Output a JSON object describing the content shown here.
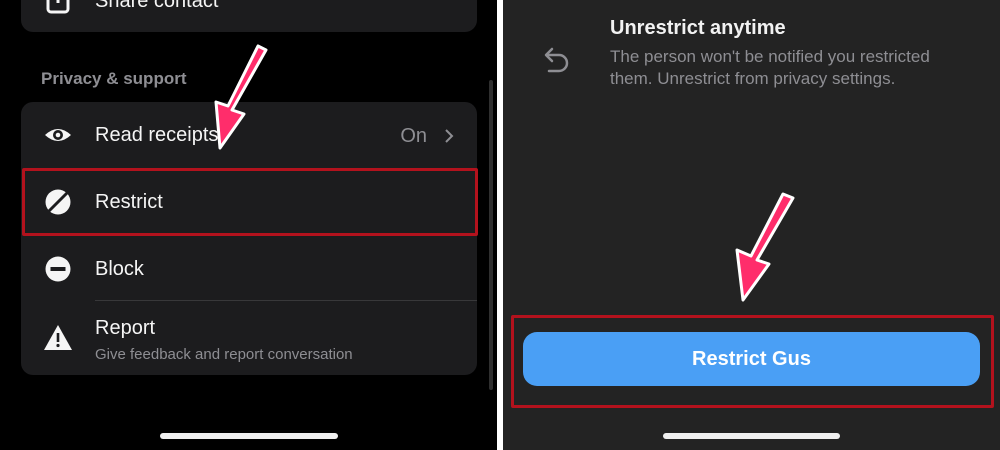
{
  "left": {
    "top_item": {
      "label": "Share contact",
      "icon": "share-icon"
    },
    "section_title": "Privacy & support",
    "items": [
      {
        "label": "Read receipts",
        "value": "On",
        "icon": "eye-icon"
      },
      {
        "label": "Restrict",
        "icon": "restrict-icon"
      },
      {
        "label": "Block",
        "icon": "block-icon"
      },
      {
        "label": "Report",
        "subtitle": "Give feedback and report conversation",
        "icon": "warning-icon"
      }
    ]
  },
  "right": {
    "title": "Unrestrict anytime",
    "description": "The person won't be notified you restricted them. Unrestrict from privacy settings.",
    "icon": "undo-icon",
    "button_label": "Restrict Gus"
  },
  "colors": {
    "highlight": "#b3121d",
    "arrow": "#ff2d6b",
    "button": "#4a9ff5"
  }
}
